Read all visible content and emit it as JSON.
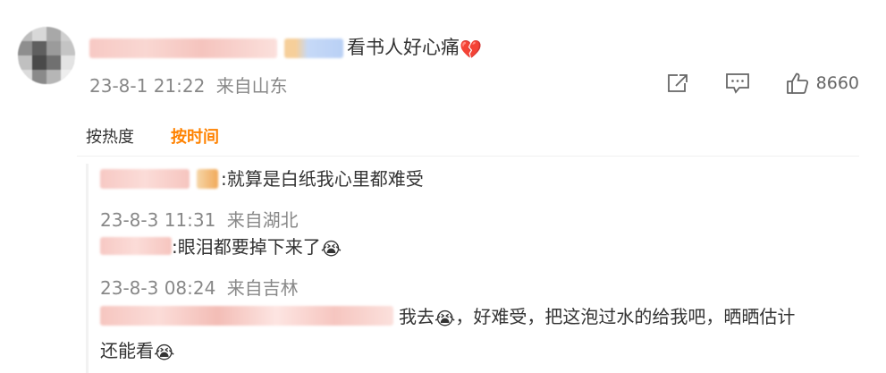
{
  "comment": {
    "text": "看书人好心痛",
    "emoji_end": "💔",
    "date": "23-8-1 21:22",
    "location": "来自山东",
    "like_count": "8660"
  },
  "icons": {
    "share": "share-icon",
    "comment": "comment-icon",
    "like": "thumbs-up-icon"
  },
  "sort": {
    "by_heat": "按热度",
    "by_time": "按时间",
    "active_color": "#ff8200"
  },
  "replies": [
    {
      "text": ":就算是白纸我心里都难受",
      "date": "23-8-3 11:31",
      "location": "来自湖北"
    },
    {
      "text": ":眼泪都要掉下来了",
      "emoji_end": "😭",
      "date": "23-8-3 08:24",
      "location": "来自吉林"
    },
    {
      "text_a": "我去",
      "emoji_mid": "😭",
      "text_b": "，好难受，把这泡过水的给我吧，晒晒估计",
      "text_c": "还能看",
      "emoji_end": "😭"
    }
  ]
}
